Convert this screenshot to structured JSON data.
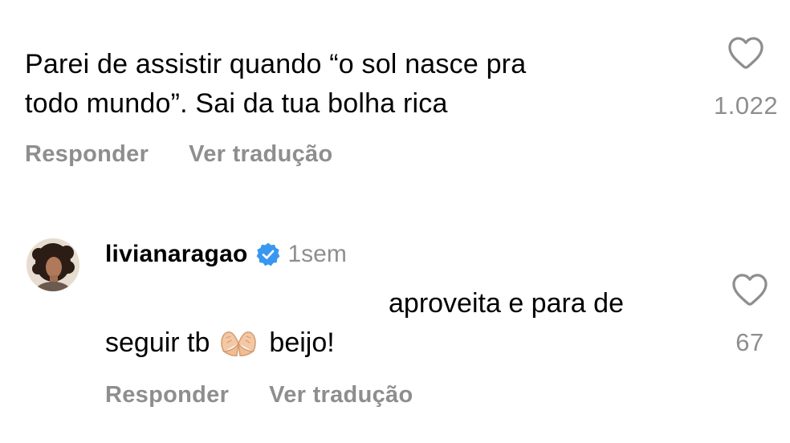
{
  "comment_1": {
    "text_line_1": "Parei de assistir quando “o sol nasce pra",
    "text_line_2": "todo mundo”. Sai da tua bolha rica",
    "like_count": "1.022",
    "reply_label": "Responder",
    "translate_label": "Ver tradução"
  },
  "comment_2": {
    "username": "livianaragao",
    "verified": true,
    "time": "1sem",
    "text_line_1": "aproveita e para de",
    "text_line_2_before_emoji": "seguir tb",
    "emoji": "heart-hands-emoji",
    "text_line_2_after_emoji": "beijo!",
    "like_count": "67",
    "reply_label": "Responder",
    "translate_label": "Ver tradução"
  },
  "colors": {
    "text": "#000000",
    "muted": "#8e8e8e",
    "verified_badge": "#3897f0",
    "background": "#ffffff"
  },
  "icons": {
    "like": "heart-outline-icon",
    "verified": "verified-badge-icon"
  }
}
